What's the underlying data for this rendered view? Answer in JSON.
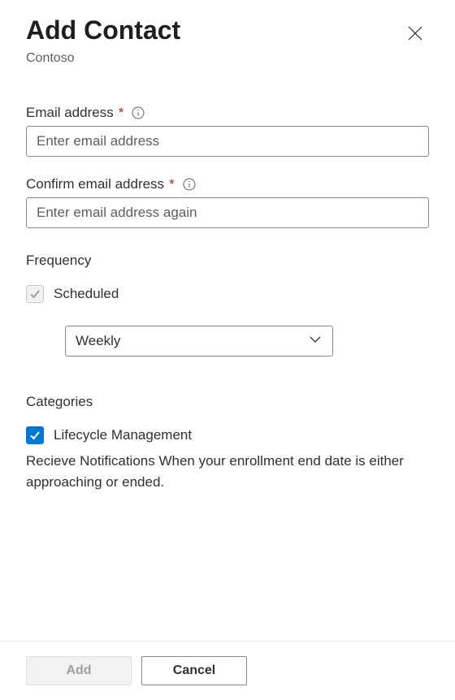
{
  "header": {
    "title": "Add Contact",
    "subtitle": "Contoso"
  },
  "fields": {
    "email": {
      "label": "Email address",
      "placeholder": "Enter email address"
    },
    "confirmEmail": {
      "label": "Confirm email address",
      "placeholder": "Enter email address again"
    }
  },
  "frequency": {
    "label": "Frequency",
    "scheduledLabel": "Scheduled",
    "dropdownValue": "Weekly"
  },
  "categories": {
    "label": "Categories",
    "lifecycle": {
      "label": "Lifecycle Management",
      "description": "Recieve Notifications When your enrollment end date is either approaching or ended."
    }
  },
  "footer": {
    "addLabel": "Add",
    "cancelLabel": "Cancel"
  },
  "requiredMark": "*"
}
